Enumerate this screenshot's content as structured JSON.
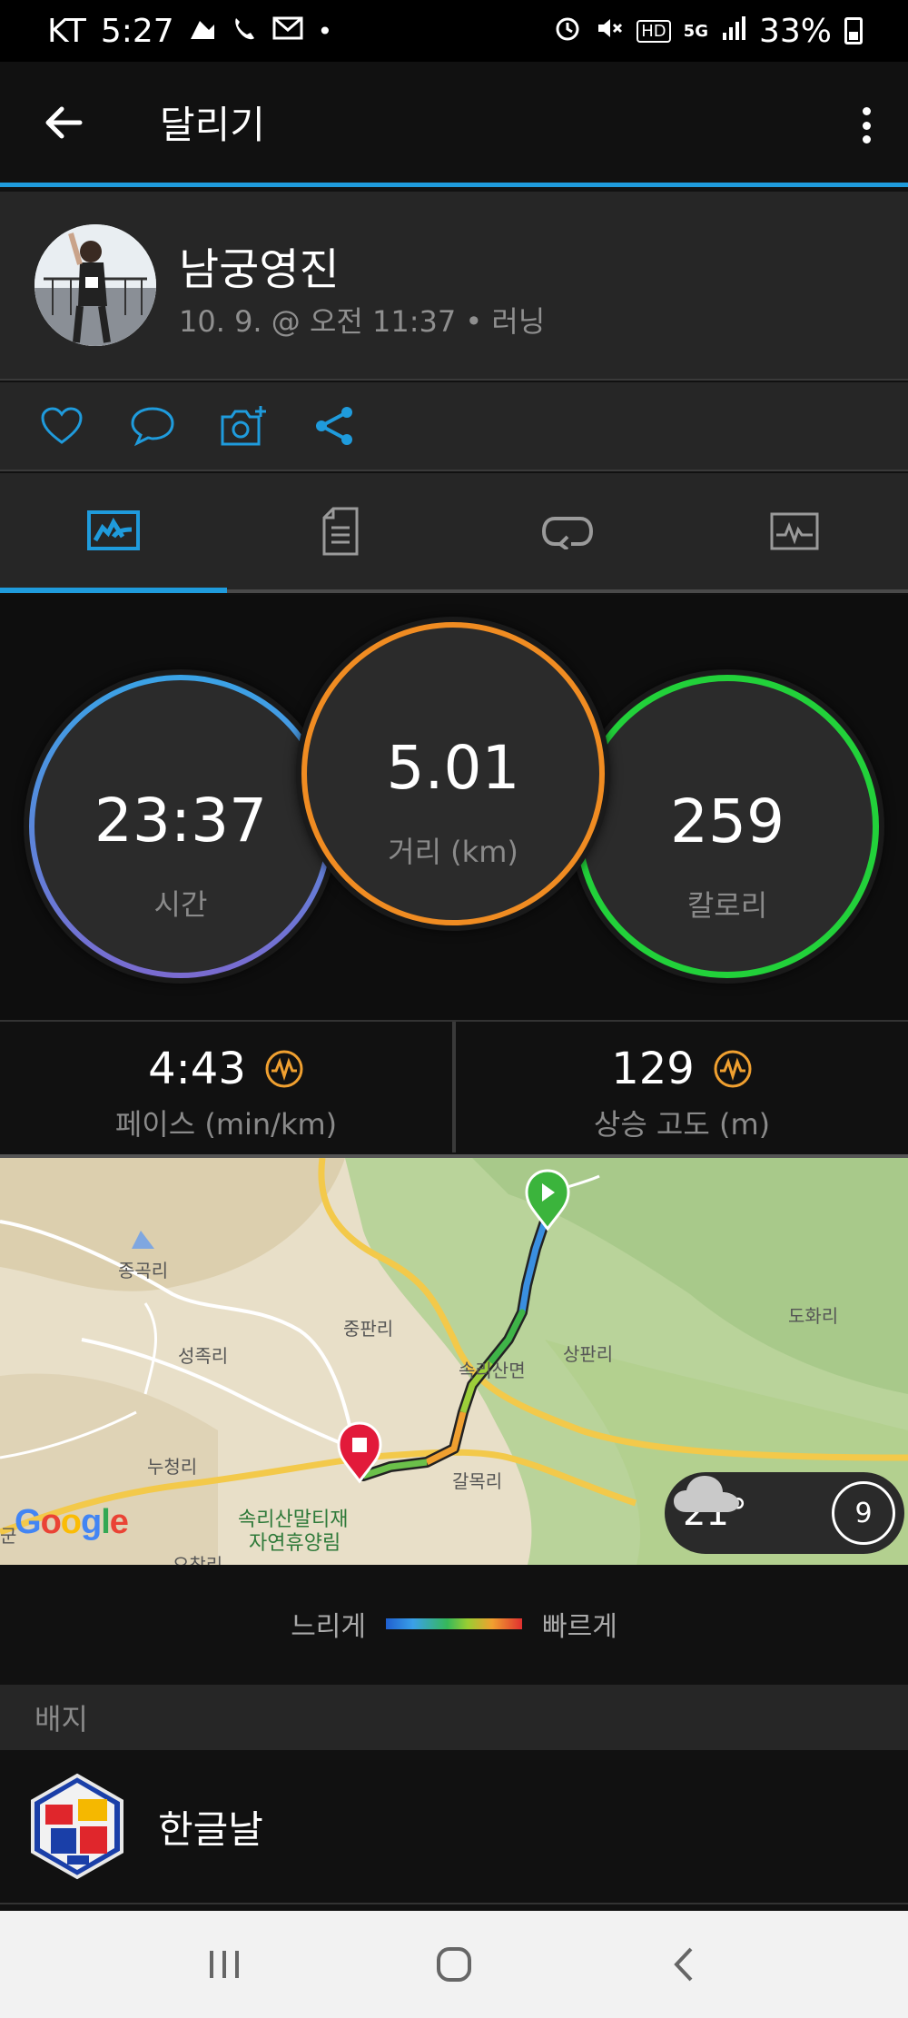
{
  "status_bar": {
    "carrier": "KT",
    "time": "5:27",
    "battery": "33%",
    "hd_label": "HD",
    "network_label": "5G"
  },
  "app_bar": {
    "title": "달리기"
  },
  "activity": {
    "user_name": "남궁영진",
    "meta": "10. 9. @ 오전 11:37 • 러닝"
  },
  "stats": {
    "time_value": "23:37",
    "time_label": "시간",
    "distance_value": "5.01",
    "distance_label": "거리 (km)",
    "calories_value": "259",
    "calories_label": "칼로리"
  },
  "metrics": {
    "pace_value": "4:43",
    "pace_label": "페이스 (min/km)",
    "ascent_value": "129",
    "ascent_label": "상승 고도 (m)"
  },
  "map": {
    "labels": [
      "종곡리",
      "성족리",
      "중판리",
      "상판리",
      "도화리",
      "누청리",
      "갈목리",
      "속리산면",
      "속리산말티재",
      "자연휴양림",
      "오창리",
      "군"
    ],
    "google_logo": "Google",
    "weather_temp": "21°",
    "wind_speed": "9"
  },
  "legend": {
    "slow": "느리게",
    "fast": "빠르게"
  },
  "badges": {
    "header": "배지",
    "items": [
      {
        "name": "한글날"
      }
    ]
  },
  "colors": {
    "accent": "#1f9bdc",
    "time_ring": "#3aa3e6",
    "distance_ring": "#f08c22",
    "calories_ring": "#22d13a",
    "training_effect": "#f0a030"
  }
}
